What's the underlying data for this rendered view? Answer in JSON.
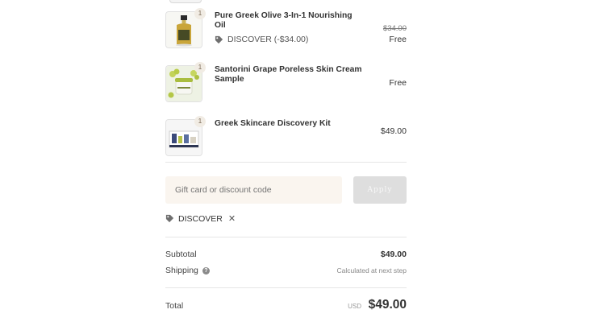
{
  "items": [
    {
      "name": "Pure Greek Olive 3-In-1 Nourishing Oil",
      "quantity": "1",
      "discount_label": "DISCOVER (-$34.00)",
      "original_price": "$34.00",
      "price": "Free",
      "image": "olive-oil-bottle"
    },
    {
      "name": "Santorini Grape Poreless Skin Cream Sample",
      "quantity": "1",
      "price": "Free",
      "image": "skin-cream-jar-with-grapes"
    },
    {
      "name": "Greek Skincare Discovery Kit",
      "quantity": "1",
      "price": "$49.00",
      "image": "skincare-kit-box"
    }
  ],
  "discount_form": {
    "placeholder": "Gift card or discount code",
    "apply_label": "Apply"
  },
  "applied_discount": {
    "code": "DISCOVER",
    "icon": "tag-icon"
  },
  "totals": {
    "subtotal_label": "Subtotal",
    "subtotal_value": "$49.00",
    "shipping_label": "Shipping",
    "shipping_help": "?",
    "shipping_value": "Calculated at next step",
    "total_label": "Total",
    "currency": "USD",
    "total_value": "$49.00"
  },
  "colors": {
    "input_background": "#faf5ef",
    "apply_button_background": "#dedede",
    "badge_background": "#f1ece4",
    "divider": "#e6e6e6"
  }
}
